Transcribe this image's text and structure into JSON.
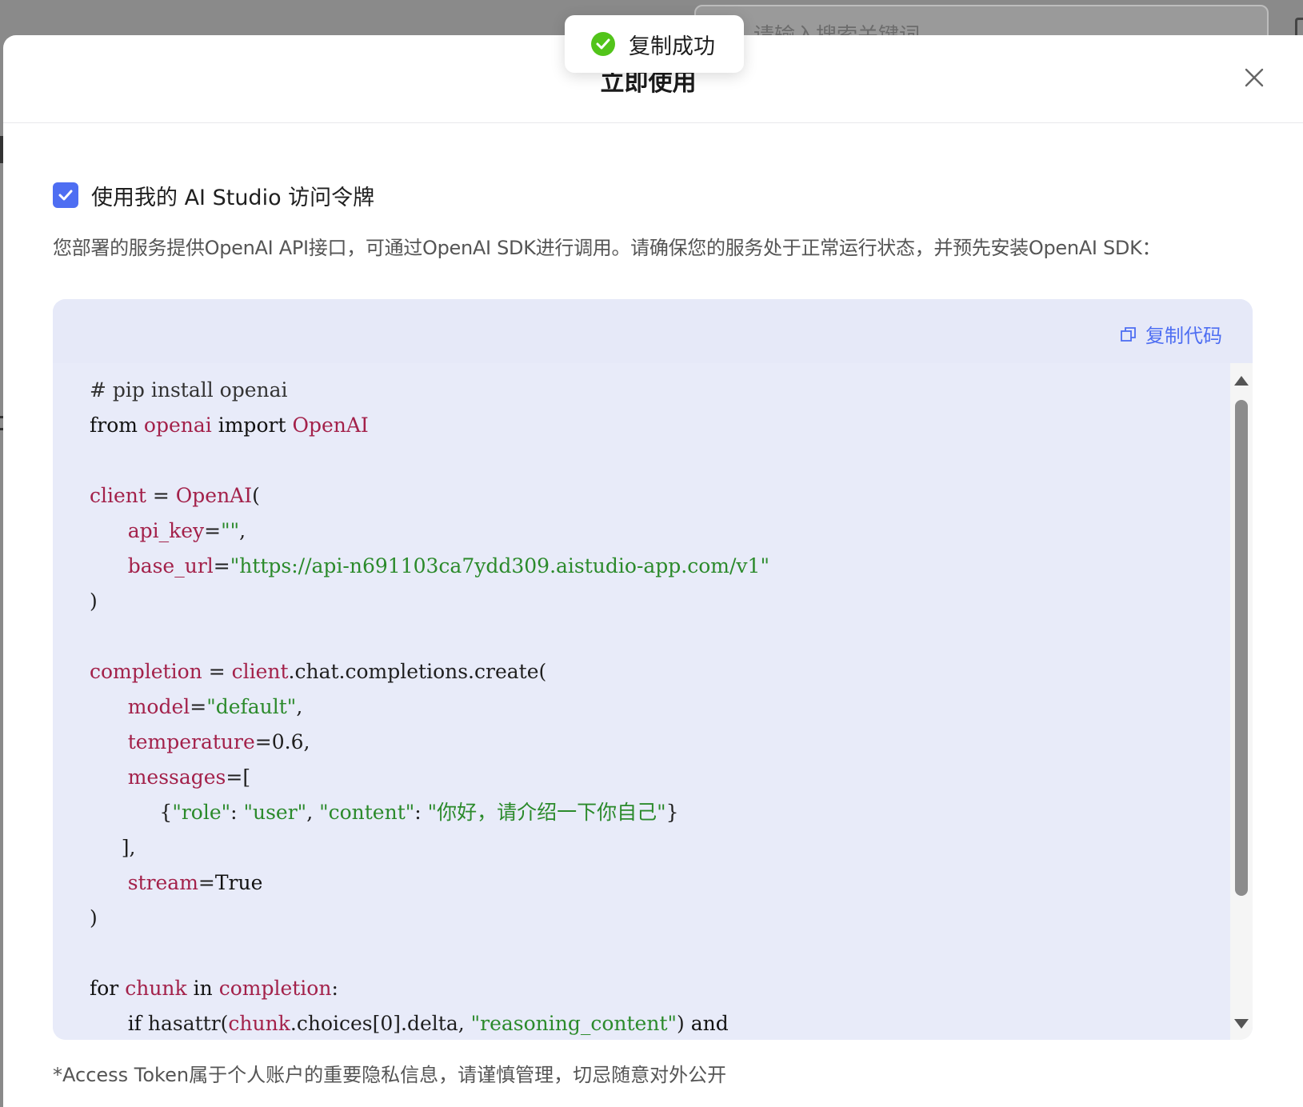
{
  "background": {
    "search_placeholder": "请输入搜索关键词"
  },
  "modal": {
    "title": "立即使用",
    "close_icon": "close-icon"
  },
  "token_option": {
    "checked": true,
    "label": "使用我的 AI Studio 访问令牌"
  },
  "description": "您部署的服务提供OpenAI API接口，可通过OpenAI SDK进行调用。请确保您的服务处于正常运行状态，并预先安装OpenAI SDK：",
  "code_block": {
    "copy_label": "复制代码",
    "copy_icon": "copy-icon",
    "lines": [
      [
        {
          "t": "# pip install openai",
          "c": "cm"
        }
      ],
      [
        {
          "t": "from",
          "c": "kw"
        },
        {
          "t": " ",
          "c": "pl"
        },
        {
          "t": "openai",
          "c": "nm"
        },
        {
          "t": " ",
          "c": "pl"
        },
        {
          "t": "import",
          "c": "kw"
        },
        {
          "t": " ",
          "c": "pl"
        },
        {
          "t": "OpenAI",
          "c": "nm"
        }
      ],
      [],
      [
        {
          "t": "client",
          "c": "nm"
        },
        {
          "t": " = ",
          "c": "pl"
        },
        {
          "t": "OpenAI",
          "c": "nm"
        },
        {
          "t": "(",
          "c": "pl"
        }
      ],
      [
        {
          "t": "      ",
          "c": "pl"
        },
        {
          "t": "api_key",
          "c": "nm"
        },
        {
          "t": "=",
          "c": "pl"
        },
        {
          "t": "\"\"",
          "c": "st"
        },
        {
          "t": ",",
          "c": "pl"
        }
      ],
      [
        {
          "t": "      ",
          "c": "pl"
        },
        {
          "t": "base_url",
          "c": "nm"
        },
        {
          "t": "=",
          "c": "pl"
        },
        {
          "t": "\"https://api-n691103ca7ydd309.aistudio-app.com/v1\"",
          "c": "st"
        }
      ],
      [
        {
          "t": ")",
          "c": "pl"
        }
      ],
      [],
      [
        {
          "t": "completion",
          "c": "nm"
        },
        {
          "t": " = ",
          "c": "pl"
        },
        {
          "t": "client",
          "c": "nm"
        },
        {
          "t": ".chat.completions.create(",
          "c": "pl"
        }
      ],
      [
        {
          "t": "      ",
          "c": "pl"
        },
        {
          "t": "model",
          "c": "nm"
        },
        {
          "t": "=",
          "c": "pl"
        },
        {
          "t": "\"default\"",
          "c": "st"
        },
        {
          "t": ",",
          "c": "pl"
        }
      ],
      [
        {
          "t": "      ",
          "c": "pl"
        },
        {
          "t": "temperature",
          "c": "nm"
        },
        {
          "t": "=0.6,",
          "c": "pl"
        }
      ],
      [
        {
          "t": "      ",
          "c": "pl"
        },
        {
          "t": "messages",
          "c": "nm"
        },
        {
          "t": "=[",
          "c": "pl"
        }
      ],
      [
        {
          "t": "           {",
          "c": "pl"
        },
        {
          "t": "\"role\"",
          "c": "st"
        },
        {
          "t": ": ",
          "c": "pl"
        },
        {
          "t": "\"user\"",
          "c": "st"
        },
        {
          "t": ", ",
          "c": "pl"
        },
        {
          "t": "\"content\"",
          "c": "st"
        },
        {
          "t": ": ",
          "c": "pl"
        },
        {
          "t": "\"你好，请介绍一下你自己\"",
          "c": "st"
        },
        {
          "t": "}",
          "c": "pl"
        }
      ],
      [
        {
          "t": "     ],",
          "c": "pl"
        }
      ],
      [
        {
          "t": "      ",
          "c": "pl"
        },
        {
          "t": "stream",
          "c": "nm"
        },
        {
          "t": "=",
          "c": "pl"
        },
        {
          "t": "True",
          "c": "kw"
        }
      ],
      [
        {
          "t": ")",
          "c": "pl"
        }
      ],
      [],
      [
        {
          "t": "for",
          "c": "kw"
        },
        {
          "t": " ",
          "c": "pl"
        },
        {
          "t": "chunk",
          "c": "nm"
        },
        {
          "t": " ",
          "c": "pl"
        },
        {
          "t": "in",
          "c": "kw"
        },
        {
          "t": " ",
          "c": "pl"
        },
        {
          "t": "completion",
          "c": "nm"
        },
        {
          "t": ":",
          "c": "pl"
        }
      ],
      [
        {
          "t": "      ",
          "c": "pl"
        },
        {
          "t": "if",
          "c": "kw"
        },
        {
          "t": " hasattr(",
          "c": "pl"
        },
        {
          "t": "chunk",
          "c": "nm"
        },
        {
          "t": ".choices[0].delta, ",
          "c": "pl"
        },
        {
          "t": "\"reasoning_content\"",
          "c": "st"
        },
        {
          "t": ") ",
          "c": "pl"
        },
        {
          "t": "and",
          "c": "kw"
        }
      ]
    ]
  },
  "footnote": "*Access Token属于个人账户的重要隐私信息，请谨慎管理，切忌随意对外公开",
  "toast": {
    "text": "复制成功",
    "icon": "success-check-icon"
  },
  "colors": {
    "accent": "#4e6ef2",
    "code_bg": "#e8ebf9",
    "success": "#52c41a",
    "code_name": "#a3214a",
    "code_string": "#2b8a2b"
  }
}
